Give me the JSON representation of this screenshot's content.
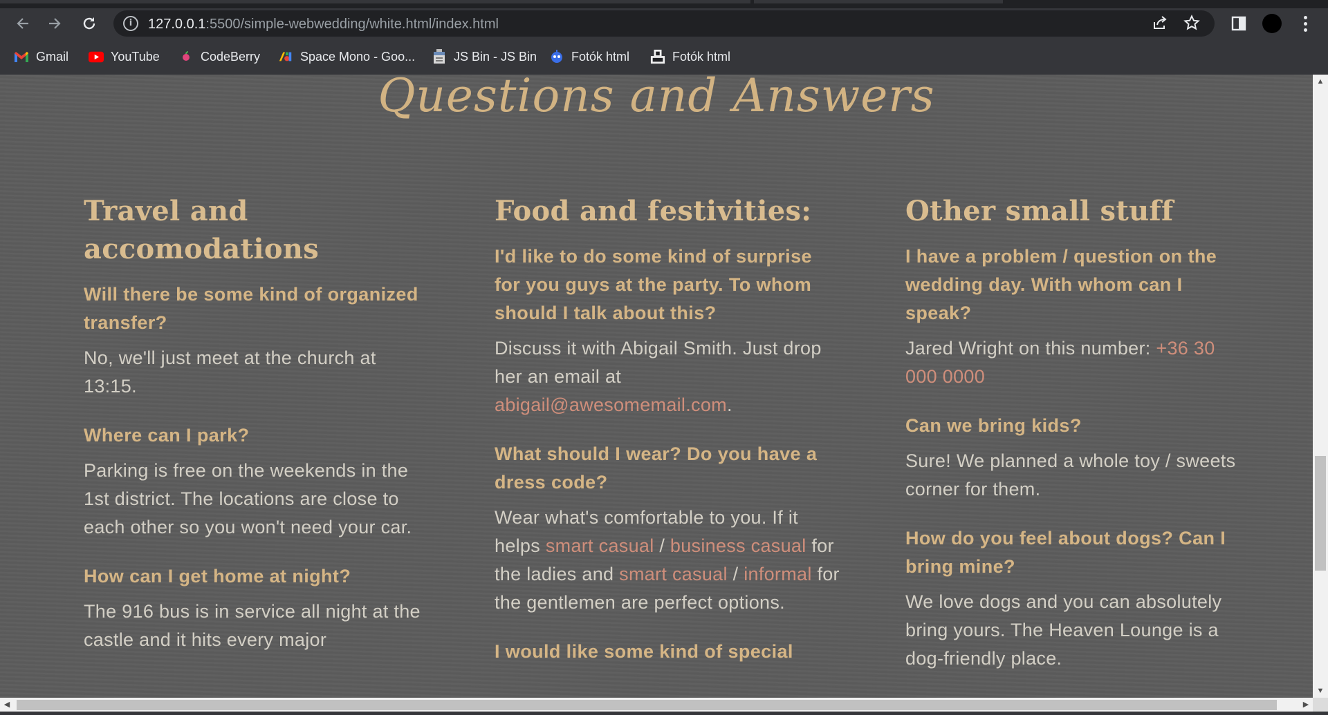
{
  "browser": {
    "url_host": "127.0.0.1",
    "url_path": ":5500/simple-webwedding/white.html/index.html",
    "bookmarks": [
      {
        "label": "Gmail",
        "icon": "gmail-icon"
      },
      {
        "label": "YouTube",
        "icon": "youtube-icon"
      },
      {
        "label": "CodeBerry",
        "icon": "codeberry-icon"
      },
      {
        "label": "Space Mono - Goo...",
        "icon": "google-fonts-icon"
      },
      {
        "label": "JS Bin - JS Bin",
        "icon": "jsbin-icon"
      },
      {
        "label": "Fotók html",
        "icon": "robot-icon"
      },
      {
        "label": "Fotók html",
        "icon": "page-icon"
      }
    ]
  },
  "page": {
    "title": "Questions and Answers",
    "columns": [
      {
        "heading": "Travel and accomodations",
        "items": [
          {
            "q": "Will there be some kind of organized transfer?",
            "a": "No, we'll just meet at the church at 13:15."
          },
          {
            "q": "Where can I park?",
            "a": "Parking is free on the weekends in the 1st district. The locations are close to each other so you won't need your car."
          },
          {
            "q": "How can I get home at night?",
            "a": "The 916 bus is in service all night at the castle and it hits every major"
          }
        ]
      },
      {
        "heading": "Food and festivities:",
        "items": [
          {
            "q": "I'd like to do some kind of surprise for you guys at the party. To whom should I talk about this?",
            "a_pre": "Discuss it with Abigail Smith. Just drop her an email at ",
            "a_link": "abigail@awesomemail.com",
            "a_post": "."
          },
          {
            "q": "What should I wear? Do you have a dress code?",
            "a_1": "Wear what's comfortable to you. If it helps ",
            "link_1": "smart casual",
            "a_2": " / ",
            "link_2": "business casual",
            "a_3": " for the ladies and ",
            "link_3": "smart casual",
            "a_4": " / ",
            "link_4": "informal",
            "a_5": " for the gentlemen are perfect options."
          },
          {
            "q": "I would like some kind of special"
          }
        ]
      },
      {
        "heading": "Other small stuff",
        "items": [
          {
            "q": "I have a problem / question on the wedding day. With whom can I speak?",
            "a_pre": "Jared Wright on this number: ",
            "a_link": "+36 30 000 0000"
          },
          {
            "q": "Can we bring kids?",
            "a": "Sure! We planned a whole toy / sweets corner for them."
          },
          {
            "q": "How do you feel about dogs? Can I bring mine?",
            "a": "We love dogs and you can absolutely bring yours. The Heaven Lounge is a dog-friendly place."
          }
        ]
      }
    ]
  },
  "colors": {
    "page_background": "#5c5c5c",
    "heading": "#d9bc8f",
    "question": "#d5b585",
    "answer": "#d3cfc5",
    "link": "#cf8e7b"
  }
}
